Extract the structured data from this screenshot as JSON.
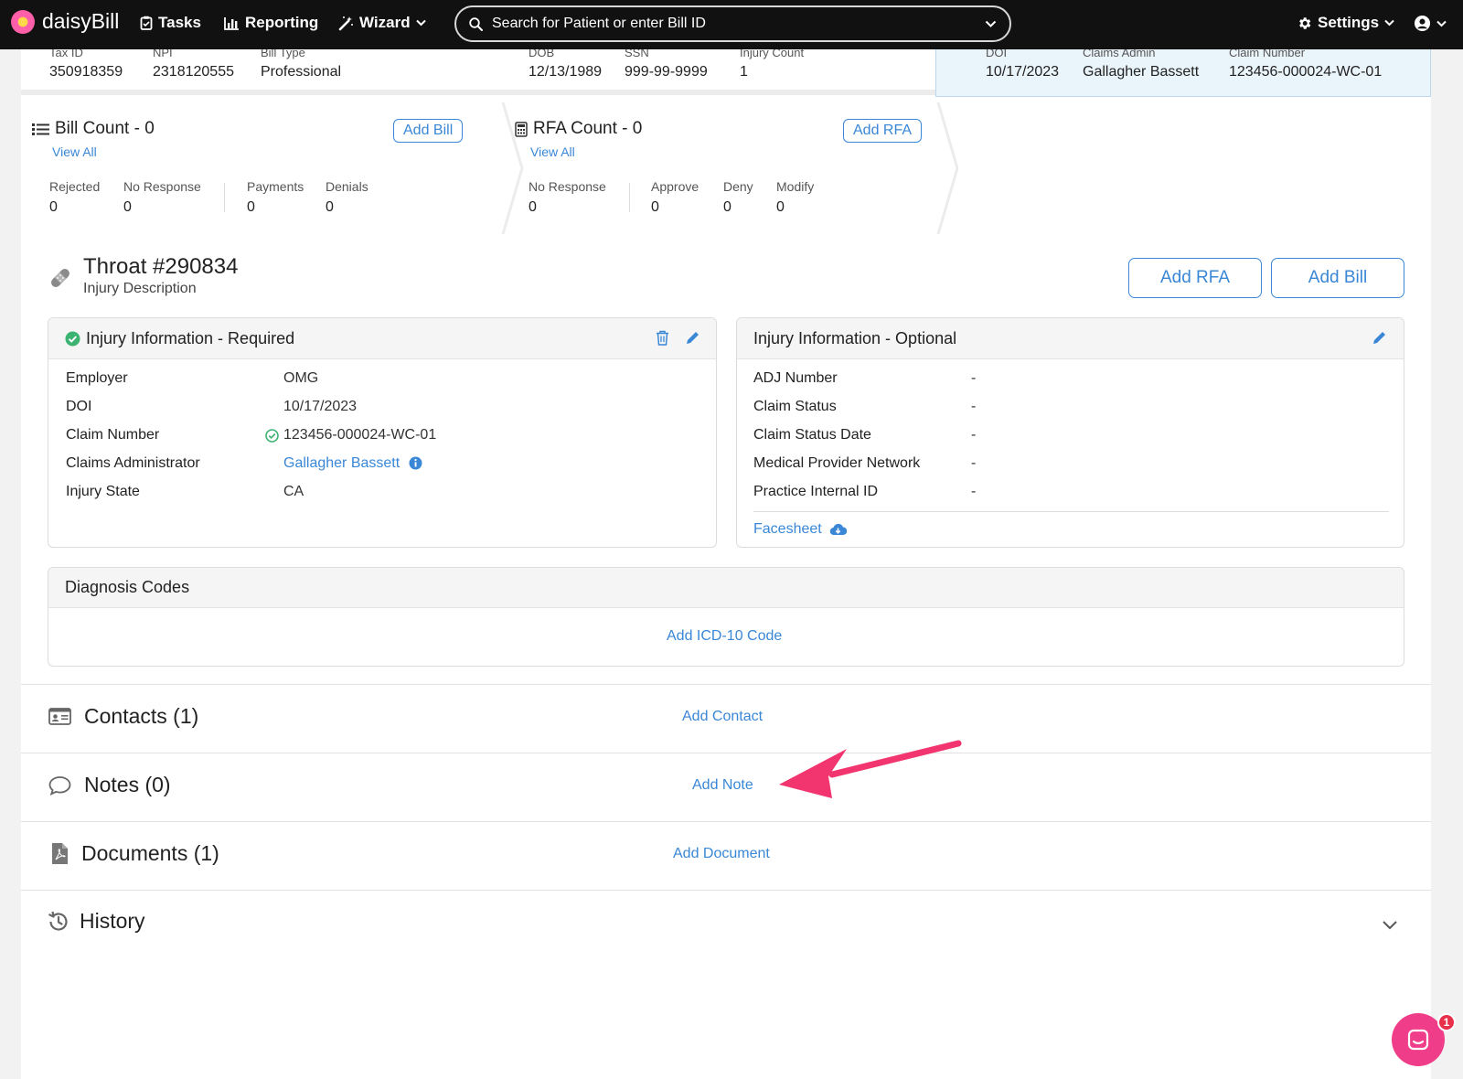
{
  "nav": {
    "logo": "daisyBill",
    "tasks": "Tasks",
    "reporting": "Reporting",
    "wizard": "Wizard",
    "search_placeholder": "Search for Patient or enter Bill ID",
    "settings": "Settings"
  },
  "summary": {
    "practice": [
      {
        "label": "Tax ID",
        "value": "350918359"
      },
      {
        "label": "NPI",
        "value": "2318120555"
      },
      {
        "label": "Bill Type",
        "value": "Professional"
      }
    ],
    "patient": [
      {
        "label": "DOB",
        "value": "12/13/1989"
      },
      {
        "label": "SSN",
        "value": "999-99-9999"
      },
      {
        "label": "Injury Count",
        "value": "1"
      }
    ],
    "claim": [
      {
        "label": "DOI",
        "value": "10/17/2023"
      },
      {
        "label": "Claims Admin",
        "value": "Gallagher Bassett"
      },
      {
        "label": "Claim Number",
        "value": "123456-000024-WC-01"
      }
    ]
  },
  "bill_count": {
    "title": "Bill Count - 0",
    "view_all": "View All",
    "add_label": "Add Bill",
    "stats": [
      {
        "label": "Rejected",
        "value": "0"
      },
      {
        "label": "No Response",
        "value": "0"
      },
      {
        "label": "Payments",
        "value": "0"
      },
      {
        "label": "Denials",
        "value": "0"
      }
    ]
  },
  "rfa_count": {
    "title": "RFA Count - 0",
    "view_all": "View All",
    "add_label": "Add RFA",
    "stats": [
      {
        "label": "No Response",
        "value": "0"
      },
      {
        "label": "Approve",
        "value": "0"
      },
      {
        "label": "Deny",
        "value": "0"
      },
      {
        "label": "Modify",
        "value": "0"
      }
    ]
  },
  "injury": {
    "title": "Throat #290834",
    "subtitle": "Injury Description",
    "add_rfa": "Add RFA",
    "add_bill": "Add Bill"
  },
  "required": {
    "title": "Injury Information - Required",
    "rows": [
      {
        "label": "Employer",
        "value": "OMG"
      },
      {
        "label": "DOI",
        "value": "10/17/2023"
      },
      {
        "label": "Claim Number",
        "value": "123456-000024-WC-01"
      },
      {
        "label": "Claims Administrator",
        "value": "Gallagher Bassett"
      },
      {
        "label": "Injury State",
        "value": "CA"
      }
    ]
  },
  "optional": {
    "title": "Injury Information - Optional",
    "rows": [
      {
        "label": "ADJ Number",
        "value": "-"
      },
      {
        "label": "Claim Status",
        "value": "-"
      },
      {
        "label": "Claim Status Date",
        "value": "-"
      },
      {
        "label": "Medical Provider Network",
        "value": "-"
      },
      {
        "label": "Practice Internal ID",
        "value": "-"
      }
    ],
    "facesheet": "Facesheet"
  },
  "diagnosis": {
    "title": "Diagnosis Codes",
    "add_label": "Add ICD-10 Code"
  },
  "sections": {
    "contacts": {
      "title": "Contacts (1)",
      "link": "Add Contact"
    },
    "notes": {
      "title": "Notes (0)",
      "link": "Add Note"
    },
    "documents": {
      "title": "Documents (1)",
      "link": "Add Document"
    },
    "history": {
      "title": "History"
    }
  },
  "chat": {
    "badge": "1"
  },
  "colors": {
    "accent": "#3a87d6",
    "annotation_arrow": "#f2346f",
    "success": "#3cb371"
  }
}
